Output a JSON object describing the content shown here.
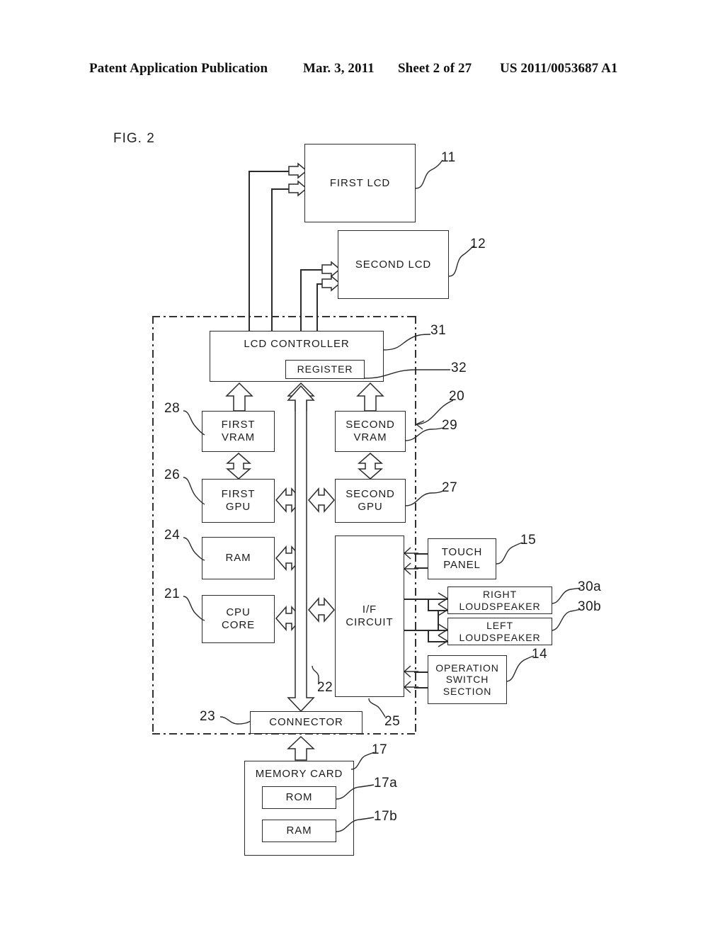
{
  "header": {
    "publication": "Patent Application Publication",
    "date": "Mar. 3, 2011",
    "sheet": "Sheet 2 of 27",
    "document_number": "US 2011/0053687 A1"
  },
  "figure": {
    "label": "FIG. 2"
  },
  "blocks": {
    "first_lcd": "FIRST LCD",
    "second_lcd": "SECOND LCD",
    "lcd_controller": "LCD CONTROLLER",
    "register": "REGISTER",
    "first_vram_l1": "FIRST",
    "first_vram_l2": "VRAM",
    "second_vram_l1": "SECOND",
    "second_vram_l2": "VRAM",
    "first_gpu_l1": "FIRST",
    "first_gpu_l2": "GPU",
    "second_gpu_l1": "SECOND",
    "second_gpu_l2": "GPU",
    "ram": "RAM",
    "cpu_core_l1": "CPU",
    "cpu_core_l2": "CORE",
    "if_circuit_l1": "I/F",
    "if_circuit_l2": "CIRCUIT",
    "touch_panel_l1": "TOUCH",
    "touch_panel_l2": "PANEL",
    "right_loudspeaker_l1": "RIGHT",
    "right_loudspeaker_l2": "LOUDSPEAKER",
    "left_loudspeaker_l1": "LEFT",
    "left_loudspeaker_l2": "LOUDSPEAKER",
    "operation_switch_l1": "OPERATION",
    "operation_switch_l2": "SWITCH",
    "operation_switch_l3": "SECTION",
    "connector": "CONNECTOR",
    "memory_card": "MEMORY CARD",
    "card_rom": "ROM",
    "card_ram": "RAM"
  },
  "reference_numerals": {
    "first_lcd": "11",
    "second_lcd": "12",
    "lcd_controller": "31",
    "register": "32",
    "system": "20",
    "first_vram": "28",
    "second_vram": "29",
    "first_gpu": "26",
    "second_gpu": "27",
    "ram": "24",
    "cpu_core": "21",
    "bus": "22",
    "if_circuit": "25",
    "touch_panel": "15",
    "right_loudspeaker": "30a",
    "left_loudspeaker": "30b",
    "operation_switch": "14",
    "connector": "23",
    "memory_card": "17",
    "card_rom": "17a",
    "card_ram": "17b"
  },
  "colors": {
    "ink": "#1c1c1c",
    "line": "#2b2b2b",
    "page": "#ffffff"
  }
}
